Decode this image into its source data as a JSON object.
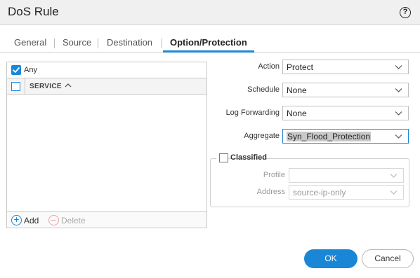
{
  "dialog": {
    "title": "DoS Rule",
    "help_icon": "help-icon",
    "help_glyph": "?"
  },
  "tabs": [
    {
      "label": "General",
      "active": false
    },
    {
      "label": "Source",
      "active": false
    },
    {
      "label": "Destination",
      "active": false
    },
    {
      "label": "Option/Protection",
      "active": true
    }
  ],
  "service_list": {
    "any_label": "Any",
    "any_checked": true,
    "column_header": "SERVICE",
    "sort": "ascending",
    "rows": [],
    "add_label": "Add",
    "delete_label": "Delete"
  },
  "options": {
    "action": {
      "label": "Action",
      "value": "Protect"
    },
    "schedule": {
      "label": "Schedule",
      "value": "None"
    },
    "log_forwarding": {
      "label": "Log Forwarding",
      "value": "None"
    },
    "aggregate": {
      "label": "Aggregate",
      "value": "Syn_Flood_Protection"
    }
  },
  "classified": {
    "label": "Classified",
    "checked": false,
    "profile": {
      "label": "Profile",
      "value": ""
    },
    "address": {
      "label": "Address",
      "value": "source-ip-only"
    }
  },
  "buttons": {
    "ok": "OK",
    "cancel": "Cancel"
  },
  "colors": {
    "accent": "#1a87d6",
    "delete_icon": "#e8a4a4"
  }
}
